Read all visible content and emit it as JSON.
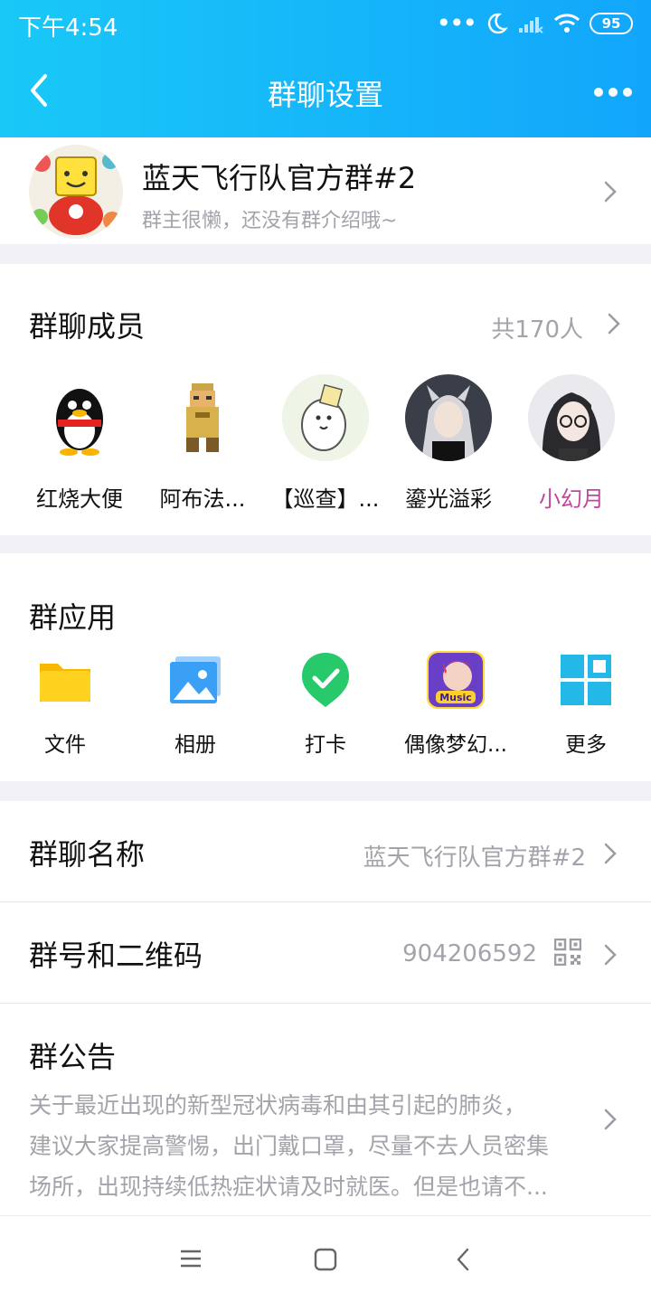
{
  "status_bar": {
    "time": "下午4:54",
    "dots": "•••",
    "battery": "95"
  },
  "header": {
    "title": "群聊设置"
  },
  "group": {
    "name": "蓝天飞行队官方群#2",
    "description": "群主很懒，还没有群介绍哦~"
  },
  "members": {
    "title": "群聊成员",
    "count": "共170人",
    "items": [
      {
        "name": "红烧大便"
      },
      {
        "name": "阿布法..."
      },
      {
        "name": "【巡查】..."
      },
      {
        "name": "鎏光溢彩"
      },
      {
        "name": "小幻月",
        "color": "#c0479a"
      }
    ]
  },
  "apps": {
    "title": "群应用",
    "items": [
      {
        "label": "文件",
        "icon": "folder-icon"
      },
      {
        "label": "相册",
        "icon": "photo-album-icon"
      },
      {
        "label": "打卡",
        "icon": "check-in-icon"
      },
      {
        "label": "偶像梦幻...",
        "icon": "idol-game-icon"
      },
      {
        "label": "更多",
        "icon": "grid-more-icon"
      }
    ]
  },
  "settings": {
    "group_name": {
      "label": "群聊名称",
      "value": "蓝天飞行队官方群#2"
    },
    "group_id": {
      "label": "群号和二维码",
      "value": "904206592"
    },
    "announcement": {
      "label": "群公告",
      "lines": [
        "关于最近出现的新型冠状病毒和由其引起的肺炎，",
        "建议大家提高警惕，出门戴口罩，尽量不去人员密集",
        "场所，出现持续低热症状请及时就医。但是也请不..."
      ]
    }
  },
  "colors": {
    "header_start": "#19c8f7",
    "header_end": "#12a6fb",
    "secondary_text": "#a3a3ab"
  }
}
